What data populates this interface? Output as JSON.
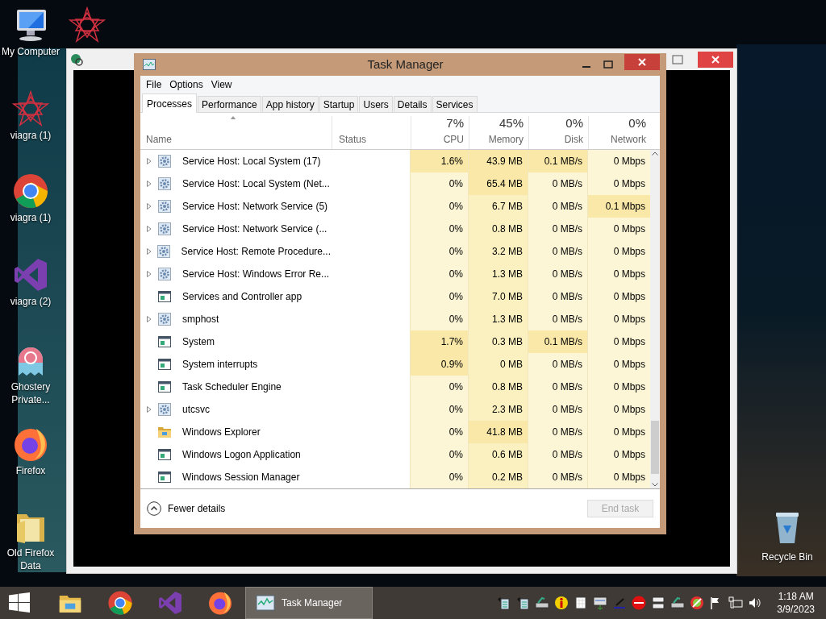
{
  "desktop_icons": [
    {
      "label": "My Computer",
      "kind": "computer"
    },
    {
      "kind": "star"
    },
    {
      "label": "viagra (1)",
      "kind": "star"
    },
    {
      "label": "viagra (1)",
      "kind": "chrome"
    },
    {
      "label": "viagra (2)",
      "kind": "vs"
    },
    {
      "label": "Ghostery Private...",
      "kind": "ghost"
    },
    {
      "label": "Firefox",
      "kind": "firefox"
    },
    {
      "label": "Old Firefox Data",
      "kind": "folder"
    }
  ],
  "recycle_bin": {
    "label": "Recycle Bin"
  },
  "task_manager": {
    "title": "Task Manager",
    "menu": [
      "File",
      "Options",
      "View"
    ],
    "tabs": [
      {
        "label": "Processes",
        "selected": true
      },
      {
        "label": "Performance",
        "selected": false
      },
      {
        "label": "App history",
        "selected": false
      },
      {
        "label": "Startup",
        "selected": false
      },
      {
        "label": "Users",
        "selected": false
      },
      {
        "label": "Details",
        "selected": false
      },
      {
        "label": "Services",
        "selected": false
      }
    ],
    "name_header": "Name",
    "status_header": "Status",
    "columns": [
      {
        "label": "CPU",
        "total": "7%"
      },
      {
        "label": "Memory",
        "total": "45%"
      },
      {
        "label": "Disk",
        "total": "0%"
      },
      {
        "label": "Network",
        "total": "0%"
      }
    ],
    "rows": [
      {
        "name": "Service Host: Local System (17)",
        "kind": "service",
        "expandable": true,
        "cells": [
          {
            "text": "1.6%",
            "hot": true
          },
          {
            "text": "43.9 MB",
            "hot": true
          },
          {
            "text": "0.1 MB/s",
            "hot": true
          },
          {
            "text": "0 Mbps",
            "hot": false
          }
        ]
      },
      {
        "name": "Service Host: Local System (Net...",
        "kind": "service",
        "expandable": true,
        "cells": [
          {
            "text": "0%",
            "hot": false
          },
          {
            "text": "65.4 MB",
            "hot": true
          },
          {
            "text": "0 MB/s",
            "hot": false
          },
          {
            "text": "0 Mbps",
            "hot": false
          }
        ]
      },
      {
        "name": "Service Host: Network Service (5)",
        "kind": "service",
        "expandable": true,
        "cells": [
          {
            "text": "0%",
            "hot": false
          },
          {
            "text": "6.7 MB",
            "hot": false
          },
          {
            "text": "0 MB/s",
            "hot": false
          },
          {
            "text": "0.1 Mbps",
            "hot": true
          }
        ]
      },
      {
        "name": "Service Host: Network Service (...",
        "kind": "service",
        "expandable": true,
        "cells": [
          {
            "text": "0%",
            "hot": false
          },
          {
            "text": "0.8 MB",
            "hot": false
          },
          {
            "text": "0 MB/s",
            "hot": false
          },
          {
            "text": "0 Mbps",
            "hot": false
          }
        ]
      },
      {
        "name": "Service Host: Remote Procedure...",
        "kind": "service",
        "expandable": true,
        "cells": [
          {
            "text": "0%",
            "hot": false
          },
          {
            "text": "3.2 MB",
            "hot": false
          },
          {
            "text": "0 MB/s",
            "hot": false
          },
          {
            "text": "0 Mbps",
            "hot": false
          }
        ]
      },
      {
        "name": "Service Host: Windows Error Re...",
        "kind": "service",
        "expandable": true,
        "cells": [
          {
            "text": "0%",
            "hot": false
          },
          {
            "text": "1.3 MB",
            "hot": false
          },
          {
            "text": "0 MB/s",
            "hot": false
          },
          {
            "text": "0 Mbps",
            "hot": false
          }
        ]
      },
      {
        "name": "Services and Controller app",
        "kind": "app",
        "expandable": false,
        "cells": [
          {
            "text": "0%",
            "hot": false
          },
          {
            "text": "7.0 MB",
            "hot": false
          },
          {
            "text": "0 MB/s",
            "hot": false
          },
          {
            "text": "0 Mbps",
            "hot": false
          }
        ]
      },
      {
        "name": "smphost",
        "kind": "service",
        "expandable": true,
        "cells": [
          {
            "text": "0%",
            "hot": false
          },
          {
            "text": "1.3 MB",
            "hot": false
          },
          {
            "text": "0 MB/s",
            "hot": false
          },
          {
            "text": "0 Mbps",
            "hot": false
          }
        ]
      },
      {
        "name": "System",
        "kind": "app",
        "expandable": false,
        "cells": [
          {
            "text": "1.7%",
            "hot": true
          },
          {
            "text": "0.3 MB",
            "hot": false
          },
          {
            "text": "0.1 MB/s",
            "hot": true
          },
          {
            "text": "0 Mbps",
            "hot": false
          }
        ]
      },
      {
        "name": "System interrupts",
        "kind": "app",
        "expandable": false,
        "cells": [
          {
            "text": "0.9%",
            "hot": true
          },
          {
            "text": "0 MB",
            "hot": false
          },
          {
            "text": "0 MB/s",
            "hot": false
          },
          {
            "text": "0 Mbps",
            "hot": false
          }
        ]
      },
      {
        "name": "Task Scheduler Engine",
        "kind": "app",
        "expandable": false,
        "cells": [
          {
            "text": "0%",
            "hot": false
          },
          {
            "text": "0.8 MB",
            "hot": false
          },
          {
            "text": "0 MB/s",
            "hot": false
          },
          {
            "text": "0 Mbps",
            "hot": false
          }
        ]
      },
      {
        "name": "utcsvc",
        "kind": "service",
        "expandable": true,
        "cells": [
          {
            "text": "0%",
            "hot": false
          },
          {
            "text": "2.3 MB",
            "hot": false
          },
          {
            "text": "0 MB/s",
            "hot": false
          },
          {
            "text": "0 Mbps",
            "hot": false
          }
        ]
      },
      {
        "name": "Windows Explorer",
        "kind": "explorer",
        "expandable": false,
        "cells": [
          {
            "text": "0%",
            "hot": false
          },
          {
            "text": "41.8 MB",
            "hot": true
          },
          {
            "text": "0 MB/s",
            "hot": false
          },
          {
            "text": "0 Mbps",
            "hot": false
          }
        ]
      },
      {
        "name": "Windows Logon Application",
        "kind": "app",
        "expandable": false,
        "cells": [
          {
            "text": "0%",
            "hot": false
          },
          {
            "text": "0.6 MB",
            "hot": false
          },
          {
            "text": "0 MB/s",
            "hot": false
          },
          {
            "text": "0 Mbps",
            "hot": false
          }
        ]
      },
      {
        "name": "Windows Session Manager",
        "kind": "app",
        "expandable": false,
        "cells": [
          {
            "text": "0%",
            "hot": false
          },
          {
            "text": "0.2 MB",
            "hot": false
          },
          {
            "text": "0 MB/s",
            "hot": false
          },
          {
            "text": "0 Mbps",
            "hot": false
          }
        ]
      }
    ],
    "fewer_details": "Fewer details",
    "end_task": {
      "label": "End task",
      "disabled": true
    }
  },
  "taskbar": {
    "pinned": [
      {
        "kind": "explorer"
      },
      {
        "kind": "chrome"
      },
      {
        "kind": "vs"
      },
      {
        "kind": "firefox"
      }
    ],
    "open_app": {
      "label": "Task Manager",
      "selected": true
    },
    "tray": [
      {
        "kind": "doc"
      },
      {
        "kind": "doc"
      },
      {
        "kind": "scanner"
      },
      {
        "kind": "info"
      },
      {
        "kind": "grid"
      },
      {
        "kind": "panel"
      },
      {
        "kind": "pen"
      },
      {
        "kind": "stop"
      },
      {
        "kind": "drive"
      },
      {
        "kind": "scanner"
      },
      {
        "kind": "block"
      },
      {
        "kind": "flag"
      },
      {
        "kind": "network"
      },
      {
        "kind": "volume"
      }
    ],
    "time": "1:18 AM",
    "date": "3/9/2023"
  }
}
